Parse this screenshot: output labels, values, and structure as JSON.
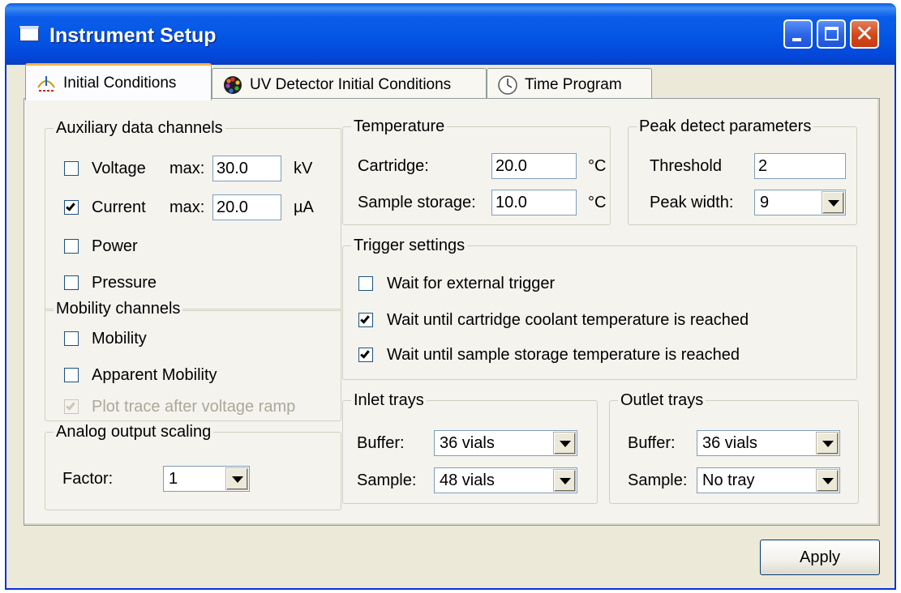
{
  "window": {
    "title": "Instrument Setup",
    "title_icon": "window-icon"
  },
  "titlebar_buttons": {
    "minimize": "minimize-icon",
    "maximize": "maximize-icon",
    "close": "close-icon"
  },
  "tabs": [
    {
      "label": "Initial Conditions",
      "icon": "initial-conditions-icon",
      "active": true
    },
    {
      "label": "UV Detector Initial Conditions",
      "icon": "uv-detector-icon",
      "active": false
    },
    {
      "label": "Time Program",
      "icon": "clock-icon",
      "active": false
    }
  ],
  "auxiliary": {
    "title": "Auxiliary data channels",
    "voltage": {
      "label": "Voltage",
      "checked": false,
      "max_label": "max:",
      "value": "30.0",
      "unit": "kV"
    },
    "current": {
      "label": "Current",
      "checked": true,
      "max_label": "max:",
      "value": "20.0",
      "unit": "µA"
    },
    "power": {
      "label": "Power",
      "checked": false
    },
    "pressure": {
      "label": "Pressure",
      "checked": false
    }
  },
  "mobility": {
    "title": "Mobility channels",
    "mobility": {
      "label": "Mobility",
      "checked": false
    },
    "apparent": {
      "label": "Apparent Mobility",
      "checked": false
    },
    "plot_trace": {
      "label": "Plot trace after voltage ramp",
      "checked": true,
      "disabled": true
    }
  },
  "analog": {
    "title": "Analog output scaling",
    "factor_label": "Factor:",
    "factor_value": "1"
  },
  "temperature": {
    "title": "Temperature",
    "cartridge_label": "Cartridge:",
    "cartridge_value": "20.0",
    "cartridge_unit": "°C",
    "storage_label": "Sample storage:",
    "storage_value": "10.0",
    "storage_unit": "°C"
  },
  "peak": {
    "title": "Peak detect parameters",
    "threshold_label": "Threshold",
    "threshold_value": "2",
    "width_label": "Peak width:",
    "width_value": "9"
  },
  "trigger": {
    "title": "Trigger settings",
    "external": {
      "label": "Wait for external trigger",
      "checked": false
    },
    "cartridge": {
      "label": "Wait until cartridge coolant temperature is reached",
      "checked": true
    },
    "storage": {
      "label": "Wait until sample storage temperature is reached",
      "checked": true
    }
  },
  "inlet": {
    "title": "Inlet trays",
    "buffer_label": "Buffer:",
    "buffer_value": "36 vials",
    "sample_label": "Sample:",
    "sample_value": "48 vials"
  },
  "outlet": {
    "title": "Outlet trays",
    "buffer_label": "Buffer:",
    "buffer_value": "36 vials",
    "sample_label": "Sample:",
    "sample_value": "No tray"
  },
  "apply_label": "Apply",
  "colors": {
    "titlebar": "#0454e4",
    "face": "#ece9d8",
    "panel": "#f4f3ee",
    "check_mark": "#21a121",
    "active_tab_accent": "#f7b34c"
  }
}
